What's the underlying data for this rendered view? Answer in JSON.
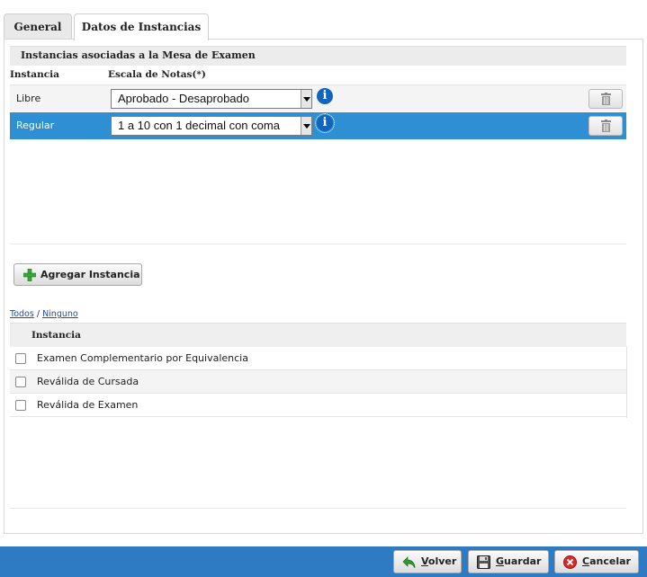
{
  "tabs": [
    {
      "label": "General"
    },
    {
      "label": "Datos de Instancias"
    }
  ],
  "section": {
    "title": "Instancias asociadas a la Mesa de Examen",
    "columns": [
      "Instancia",
      "Escala de Notas(*)"
    ]
  },
  "instancias": [
    {
      "name": "Libre",
      "escala": "Aprobado - Desaprobado",
      "selected": false
    },
    {
      "name": "Regular",
      "escala": "1 a 10 con 1 decimal con coma",
      "selected": true
    }
  ],
  "add_button": {
    "label": "Agregar Instancia"
  },
  "select_links": {
    "all": "Todos",
    "separator": "/",
    "none": "Ninguno"
  },
  "list": {
    "header": "Instancia",
    "items": [
      {
        "label": "Examen Complementario por Equivalencia",
        "checked": false
      },
      {
        "label": "Reválida de Cursada",
        "checked": false
      },
      {
        "label": "Reválida de Examen",
        "checked": false
      }
    ]
  },
  "footer": {
    "volver_accel": "V",
    "volver_rest": "olver",
    "guardar_accel": "G",
    "guardar_rest": "uardar",
    "cancelar_accel": "C",
    "cancelar_rest": "ancelar"
  },
  "colors": {
    "selected_row": "#2e8fd4",
    "footer_bar": "#2e7bc4",
    "info_icon": "#1166bb"
  }
}
